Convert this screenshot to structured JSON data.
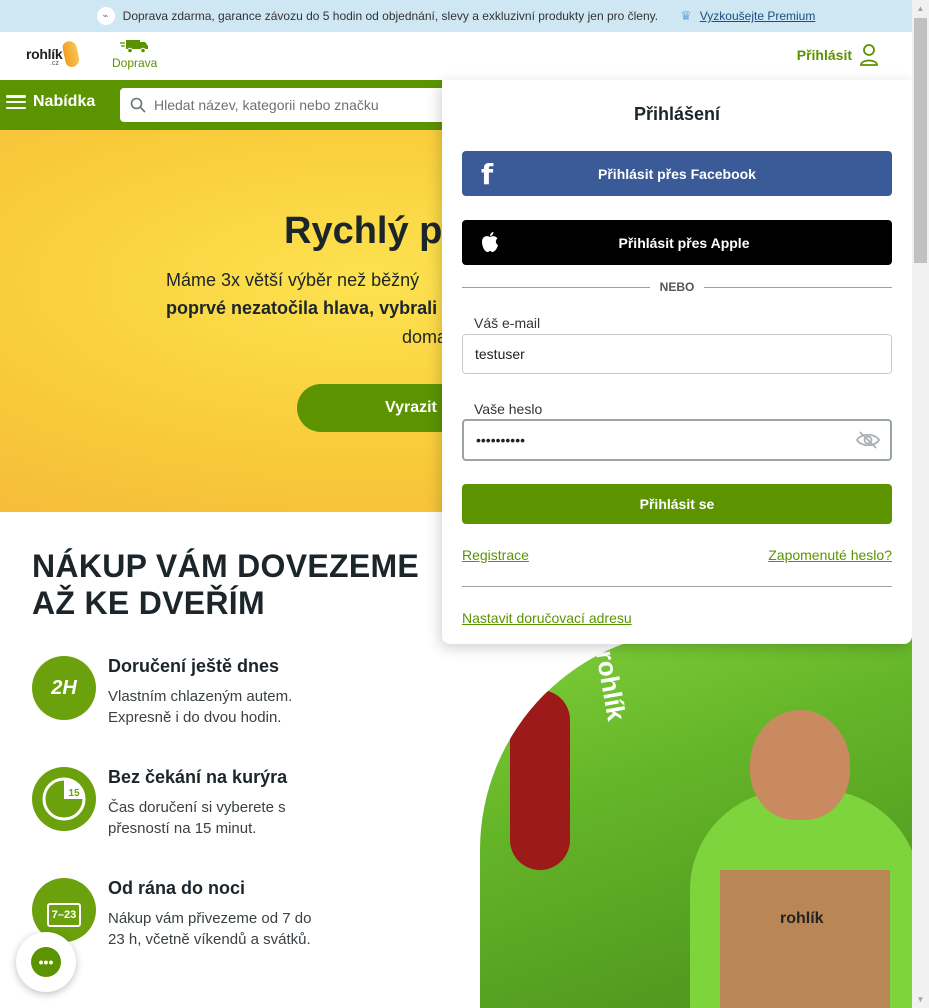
{
  "topbar": {
    "text": "Doprava zdarma, garance závozu do 5 hodin od objednání, slevy a exkluzivní produkty jen pro členy.",
    "link": "Vyzkoušejte Premium"
  },
  "header": {
    "logo_word": "rohlík",
    "logo_tld": ".cz",
    "delivery_label": "Doprava",
    "login_label": "Přihlásit"
  },
  "nav": {
    "menu_label": "Nabídka",
    "search_placeholder": "Hledat název, kategorii nebo značku"
  },
  "hero": {
    "title": "Rychlý pr",
    "line1": "Máme 3x větší výběr než běžný",
    "line2": "poprvé nezatočila hlava, vybrali",
    "line3": "doma",
    "cta": "Vyrazit"
  },
  "section": {
    "title_line1": "NÁKUP VÁM DOVEZEME",
    "title_line2": "AŽ KE DVEŘÍM",
    "features": [
      {
        "icon_text": "2H",
        "title": "Doručení ještě dnes",
        "text": "Vlastním chlazeným autem. Expresně i do dvou hodin."
      },
      {
        "icon_text": "15",
        "title": "Bez čekání na kurýra",
        "text": "Čas doručení si vyberete s přesností na 15 minut."
      },
      {
        "icon_text": "7–23",
        "title": "Od rána do noci",
        "text": "Nákup vám přivezeme od 7 do 23 h, včetně víkendů a svátků."
      }
    ]
  },
  "photo": {
    "van_text": "rohlík",
    "bag_text": "rohlík"
  },
  "login": {
    "title": "Přihlášení",
    "facebook": "Přihlásit přes Facebook",
    "apple": "Přihlásit přes Apple",
    "divider": "NEBO",
    "email_label": "Váš e-mail",
    "email_value": "testuser",
    "password_label": "Vaše heslo",
    "password_value": "••••••••••",
    "submit": "Přihlásit se",
    "register": "Registrace",
    "forgot": "Zapomenuté heslo?",
    "set_address": "Nastavit doručovací adresu"
  },
  "colors": {
    "brand_green": "#5b9400",
    "facebook": "#3b5a98",
    "hero_yellow": "#fde24f",
    "topbar": "#cfe7f2"
  }
}
